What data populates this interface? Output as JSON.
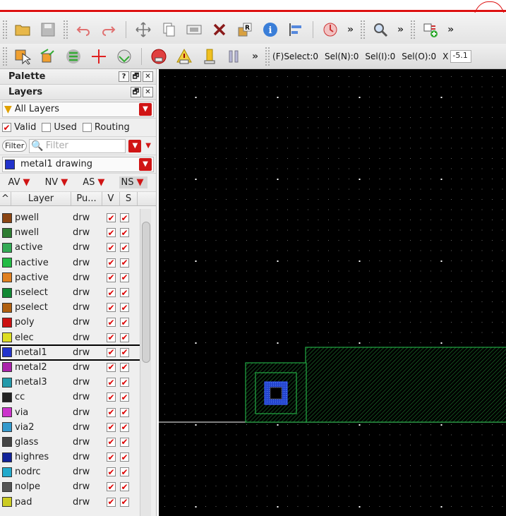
{
  "toolbar_status": {
    "fselect": "(F)Select:0",
    "seln": "Sel(N):0",
    "seli": "Sel(I):0",
    "selo": "Sel(O):0",
    "x_label": "X",
    "x_value": "-5.1"
  },
  "palette": {
    "title": "Palette",
    "help_btn": "?",
    "float_btn": "🗗",
    "close_btn": "✕"
  },
  "layers": {
    "title": "Layers",
    "filter_combo": "All Layers",
    "valid_label": "Valid",
    "used_label": "Used",
    "routing_label": "Routing",
    "filter_btn": "Filter",
    "filter_placeholder": "Filter",
    "current_layer": "metal1 drawing",
    "visibility_buttons": [
      "AV",
      "NV",
      "AS",
      "NS"
    ],
    "columns": [
      "Layer",
      "Pu...",
      "V",
      "S"
    ],
    "rows": [
      {
        "name": "pwell",
        "purpose": "drw",
        "color": "#8b4513"
      },
      {
        "name": "nwell",
        "purpose": "drw",
        "color": "#2e7d32"
      },
      {
        "name": "active",
        "purpose": "drw",
        "color": "#33aa55"
      },
      {
        "name": "nactive",
        "purpose": "drw",
        "color": "#22bb44"
      },
      {
        "name": "pactive",
        "purpose": "drw",
        "color": "#e08020"
      },
      {
        "name": "nselect",
        "purpose": "drw",
        "color": "#118833"
      },
      {
        "name": "pselect",
        "purpose": "drw",
        "color": "#b06010"
      },
      {
        "name": "poly",
        "purpose": "drw",
        "color": "#cc1111"
      },
      {
        "name": "elec",
        "purpose": "drw",
        "color": "#dddd22"
      },
      {
        "name": "metal1",
        "purpose": "drw",
        "color": "#2233cc"
      },
      {
        "name": "metal2",
        "purpose": "drw",
        "color": "#aa22aa"
      },
      {
        "name": "metal3",
        "purpose": "drw",
        "color": "#2299aa"
      },
      {
        "name": "cc",
        "purpose": "drw",
        "color": "#222222"
      },
      {
        "name": "via",
        "purpose": "drw",
        "color": "#cc33cc"
      },
      {
        "name": "via2",
        "purpose": "drw",
        "color": "#3399cc"
      },
      {
        "name": "glass",
        "purpose": "drw",
        "color": "#444444"
      },
      {
        "name": "highres",
        "purpose": "drw",
        "color": "#112299"
      },
      {
        "name": "nodrc",
        "purpose": "drw",
        "color": "#22aacc"
      },
      {
        "name": "nolpe",
        "purpose": "drw",
        "color": "#555555"
      },
      {
        "name": "pad",
        "purpose": "drw",
        "color": "#cccc22"
      }
    ],
    "selected_row": "metal1"
  },
  "colors": {
    "accent_red": "#d01414",
    "canvas_bg": "#000000",
    "shape_green": "#22aa44",
    "shape_blue": "#2244cc"
  }
}
